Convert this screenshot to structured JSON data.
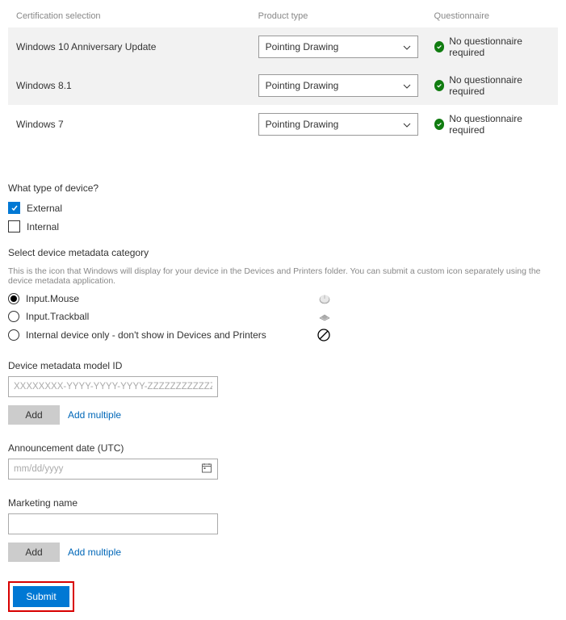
{
  "table": {
    "headers": {
      "cert": "Certification selection",
      "product": "Product type",
      "quest": "Questionnaire"
    },
    "rows": [
      {
        "cert": "Windows 10 Anniversary Update",
        "product": "Pointing Drawing",
        "status": "No questionnaire required"
      },
      {
        "cert": "Windows 8.1",
        "product": "Pointing Drawing",
        "status": "No questionnaire required"
      },
      {
        "cert": "Windows 7",
        "product": "Pointing Drawing",
        "status": "No questionnaire required"
      }
    ]
  },
  "device_type": {
    "question": "What type of device?",
    "options": {
      "external": "External",
      "internal": "Internal"
    },
    "external_checked": true,
    "internal_checked": false
  },
  "metadata_cat": {
    "label": "Select device metadata category",
    "hint": "This is the icon that Windows will display for your device in the Devices and Printers folder. You can submit a custom icon separately using the device metadata application.",
    "options": {
      "mouse": "Input.Mouse",
      "trackball": "Input.Trackball",
      "internal": "Internal device only - don't show in Devices and Printers"
    },
    "selected": "mouse"
  },
  "model_id": {
    "label": "Device metadata model ID",
    "placeholder": "XXXXXXXX-YYYY-YYYY-YYYY-ZZZZZZZZZZZZ",
    "add": "Add",
    "add_multiple": "Add multiple"
  },
  "announcement": {
    "label": "Announcement date (UTC)",
    "placeholder": "mm/dd/yyyy"
  },
  "marketing": {
    "label": "Marketing name",
    "value": "",
    "add": "Add",
    "add_multiple": "Add multiple"
  },
  "submit": "Submit"
}
